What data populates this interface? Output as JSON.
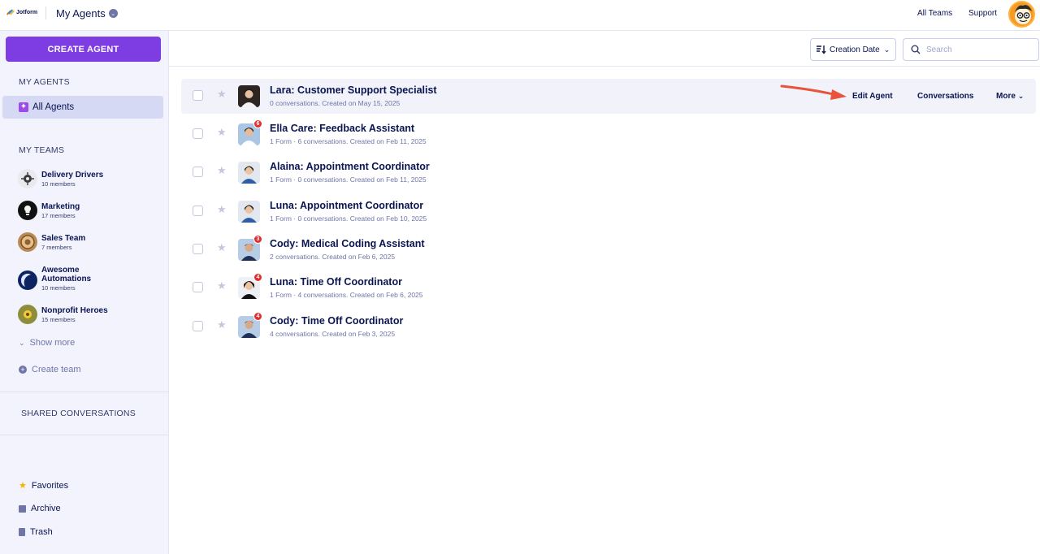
{
  "header": {
    "logo_text": "Jotform",
    "title": "My Agents",
    "links": [
      "All Teams",
      "Support"
    ]
  },
  "sidebar": {
    "create_label": "CREATE AGENT",
    "my_agents_heading": "MY AGENTS",
    "all_agents_label": "All Agents",
    "my_teams_heading": "MY TEAMS",
    "teams": [
      {
        "name": "Delivery Drivers",
        "members": "10 members"
      },
      {
        "name": "Marketing",
        "members": "17 members"
      },
      {
        "name": "Sales Team",
        "members": "7 members"
      },
      {
        "name": "Awesome Automations",
        "members": "10 members"
      },
      {
        "name": "Nonprofit Heroes",
        "members": "15 members"
      }
    ],
    "show_more": "Show more",
    "create_team": "Create team",
    "shared_heading": "SHARED CONVERSATIONS",
    "favorites": "Favorites",
    "archive": "Archive",
    "trash": "Trash"
  },
  "toolbar": {
    "sort_label": "Creation Date",
    "search_placeholder": "Search"
  },
  "agents": [
    {
      "name": "Lara: Customer Support Specialist",
      "meta": "0 conversations. Created on May 15, 2025",
      "badge": ""
    },
    {
      "name": "Ella Care: Feedback Assistant",
      "meta": "1 Form · 6 conversations. Created on Feb 11, 2025",
      "badge": "6"
    },
    {
      "name": "Alaina: Appointment Coordinator",
      "meta": "1 Form · 0 conversations. Created on Feb 11, 2025",
      "badge": ""
    },
    {
      "name": "Luna: Appointment Coordinator",
      "meta": "1 Form · 0 conversations. Created on Feb 10, 2025",
      "badge": ""
    },
    {
      "name": "Cody: Medical Coding Assistant",
      "meta": "2 conversations. Created on Feb 6, 2025",
      "badge": "3"
    },
    {
      "name": "Luna: Time Off Coordinator",
      "meta": "1 Form · 4 conversations. Created on Feb 6, 2025",
      "badge": "4"
    },
    {
      "name": "Cody: Time Off Coordinator",
      "meta": "4 conversations. Created on Feb 3, 2025",
      "badge": "4"
    }
  ],
  "row_actions": {
    "edit": "Edit Agent",
    "conversations": "Conversations",
    "more": "More"
  },
  "colors": {
    "brand_purple": "#7d3de3",
    "sidebar_bg": "#f3f3fe",
    "badge_red": "#e32d2d",
    "annotation_arrow": "#e8533c"
  }
}
